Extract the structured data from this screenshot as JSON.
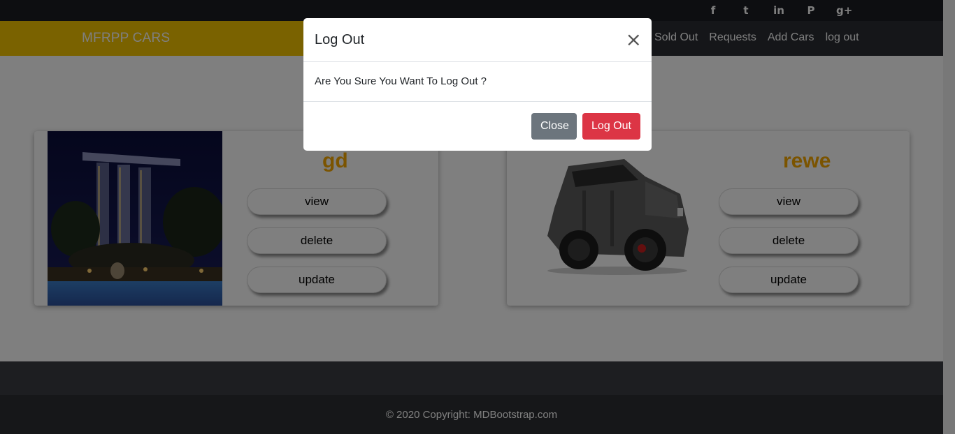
{
  "social": [
    "facebook-icon",
    "twitter-icon",
    "linkedin-icon",
    "pinterest-icon",
    "google-plus-icon"
  ],
  "social_glyphs": {
    "facebook": "f",
    "twitter": "t",
    "linkedin": "in",
    "pinterest": "P",
    "google_plus": "g+"
  },
  "brand": "MFRPP CARS",
  "nav": {
    "sold_out": "Sold Out",
    "requests": "Requests",
    "add_cars": "Add Cars",
    "logout": "log out"
  },
  "cards": [
    {
      "title": "gd",
      "view": "view",
      "delete": "delete",
      "update": "update"
    },
    {
      "title": "rewe",
      "view": "view",
      "delete": "delete",
      "update": "update"
    }
  ],
  "footer": {
    "copyright": "© 2020 Copyright: MDBootstrap.com"
  },
  "modal": {
    "title": "Log Out",
    "close_glyph": "×",
    "body": "Are You Sure You Want To Log Out ?",
    "close_label": "Close",
    "logout_label": "Log Out"
  },
  "colors": {
    "brand_yellow": "#f4c500",
    "title_orange": "#f7a800",
    "danger": "#dc3545",
    "secondary": "#6c757d"
  }
}
